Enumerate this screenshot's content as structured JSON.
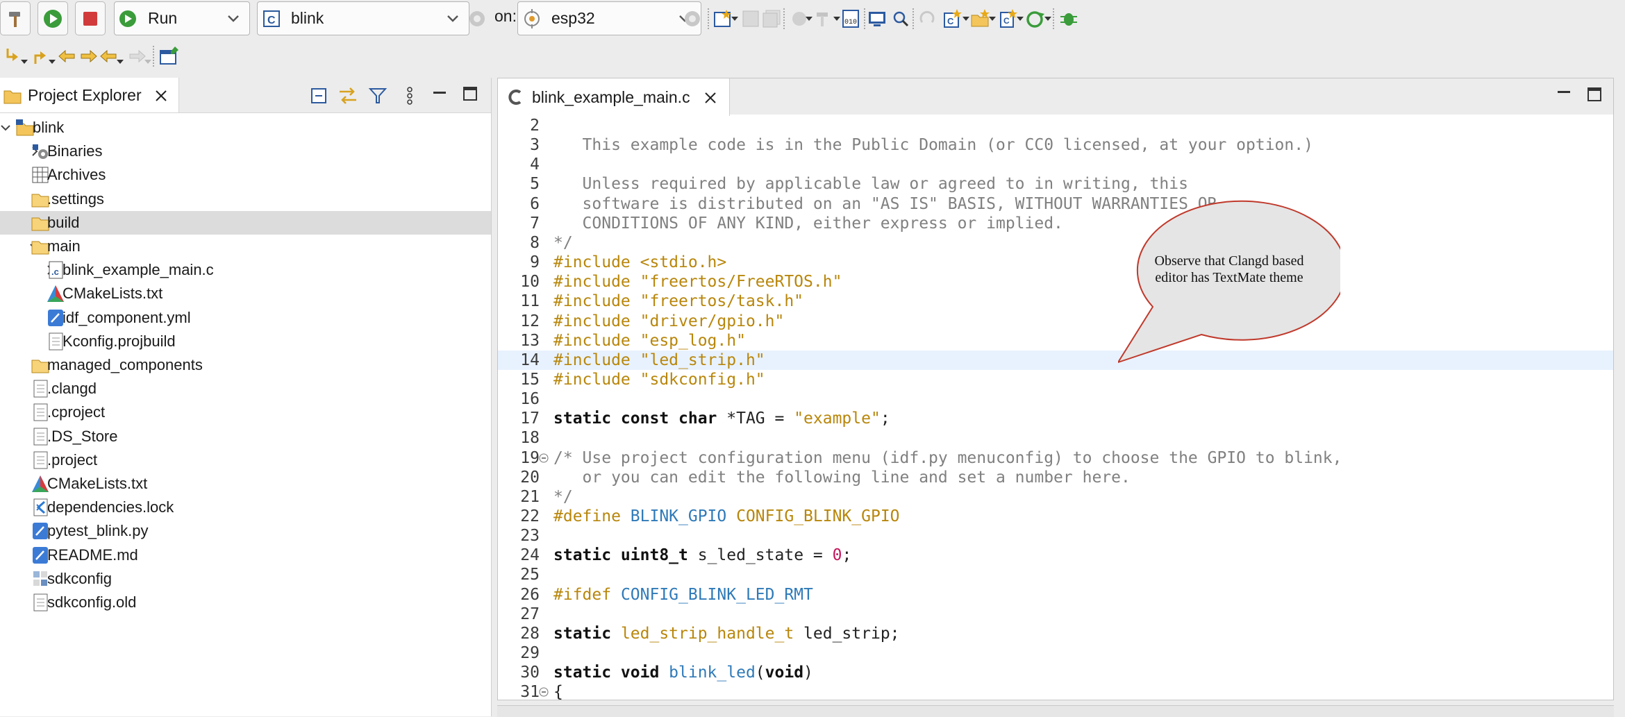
{
  "toolbar": {
    "run_mode": "Run",
    "launch_config": "blink",
    "on_label": "on:",
    "target": "esp32"
  },
  "explorer": {
    "title": "Project Explorer",
    "tree": [
      {
        "label": "blink",
        "depth": 0,
        "twisty": "expanded",
        "icon": "project-folder-icon"
      },
      {
        "label": "Binaries",
        "depth": 1,
        "twisty": "collapsed",
        "icon": "binaries-icon"
      },
      {
        "label": "Archives",
        "depth": 1,
        "twisty": "collapsed",
        "icon": "archives-icon"
      },
      {
        "label": ".settings",
        "depth": 1,
        "twisty": "collapsed",
        "icon": "folder-icon"
      },
      {
        "label": "build",
        "depth": 1,
        "twisty": "collapsed",
        "icon": "folder-icon",
        "selected": true
      },
      {
        "label": "main",
        "depth": 1,
        "twisty": "expanded",
        "icon": "folder-icon"
      },
      {
        "label": "blink_example_main.c",
        "depth": 2,
        "twisty": "collapsed",
        "icon": "c-file-icon"
      },
      {
        "label": "CMakeLists.txt",
        "depth": 2,
        "twisty": "none",
        "icon": "cmake-icon"
      },
      {
        "label": "idf_component.yml",
        "depth": 2,
        "twisty": "none",
        "icon": "yml-file-icon"
      },
      {
        "label": "Kconfig.projbuild",
        "depth": 2,
        "twisty": "none",
        "icon": "text-file-icon"
      },
      {
        "label": "managed_components",
        "depth": 1,
        "twisty": "collapsed",
        "icon": "folder-icon"
      },
      {
        "label": ".clangd",
        "depth": 1,
        "twisty": "none",
        "icon": "text-file-icon"
      },
      {
        "label": ".cproject",
        "depth": 1,
        "twisty": "none",
        "icon": "text-file-icon"
      },
      {
        "label": ".DS_Store",
        "depth": 1,
        "twisty": "none",
        "icon": "text-file-icon"
      },
      {
        "label": ".project",
        "depth": 1,
        "twisty": "none",
        "icon": "text-file-icon"
      },
      {
        "label": "CMakeLists.txt",
        "depth": 1,
        "twisty": "none",
        "icon": "cmake-icon"
      },
      {
        "label": "dependencies.lock",
        "depth": 1,
        "twisty": "none",
        "icon": "vscode-file-icon"
      },
      {
        "label": "pytest_blink.py",
        "depth": 1,
        "twisty": "none",
        "icon": "py-file-icon"
      },
      {
        "label": "README.md",
        "depth": 1,
        "twisty": "none",
        "icon": "md-file-icon"
      },
      {
        "label": "sdkconfig",
        "depth": 1,
        "twisty": "none",
        "icon": "sdkconfig-icon"
      },
      {
        "label": "sdkconfig.old",
        "depth": 1,
        "twisty": "none",
        "icon": "text-file-icon"
      }
    ]
  },
  "editor": {
    "tab_title": "blink_example_main.c",
    "current_line": 14,
    "lines": [
      {
        "n": "2",
        "tokens": []
      },
      {
        "n": "3",
        "tokens": [
          [
            "comment",
            "   This example code is in the Public Domain (or CC0 licensed, at your option.)"
          ]
        ]
      },
      {
        "n": "4",
        "tokens": []
      },
      {
        "n": "5",
        "tokens": [
          [
            "comment",
            "   Unless required by applicable law or agreed to in writing, this"
          ]
        ]
      },
      {
        "n": "6",
        "tokens": [
          [
            "comment",
            "   software is distributed on an \"AS IS\" BASIS, WITHOUT WARRANTIES OR"
          ]
        ]
      },
      {
        "n": "7",
        "tokens": [
          [
            "comment",
            "   CONDITIONS OF ANY KIND, either express or implied."
          ]
        ]
      },
      {
        "n": "8",
        "tokens": [
          [
            "comment",
            "*/"
          ]
        ]
      },
      {
        "n": "9",
        "tokens": [
          [
            "pre",
            "#include "
          ],
          [
            "str",
            "<stdio.h>"
          ]
        ]
      },
      {
        "n": "10",
        "tokens": [
          [
            "pre",
            "#include "
          ],
          [
            "str",
            "\"freertos/FreeRTOS.h\""
          ]
        ]
      },
      {
        "n": "11",
        "tokens": [
          [
            "pre",
            "#include "
          ],
          [
            "str",
            "\"freertos/task.h\""
          ]
        ]
      },
      {
        "n": "12",
        "tokens": [
          [
            "pre",
            "#include "
          ],
          [
            "str",
            "\"driver/gpio.h\""
          ]
        ]
      },
      {
        "n": "13",
        "tokens": [
          [
            "pre",
            "#include "
          ],
          [
            "str",
            "\"esp_log.h\""
          ]
        ]
      },
      {
        "n": "14",
        "tokens": [
          [
            "pre",
            "#include "
          ],
          [
            "str",
            "\"led_strip.h\""
          ]
        ]
      },
      {
        "n": "15",
        "tokens": [
          [
            "pre",
            "#include "
          ],
          [
            "str",
            "\"sdkconfig.h\""
          ]
        ]
      },
      {
        "n": "16",
        "tokens": []
      },
      {
        "n": "17",
        "tokens": [
          [
            "kw",
            "static const char "
          ],
          [
            "plain",
            "*TAG = "
          ],
          [
            "str",
            "\"example\""
          ],
          [
            "plain",
            ";"
          ]
        ]
      },
      {
        "n": "18",
        "tokens": []
      },
      {
        "n": "19",
        "fold": true,
        "tokens": [
          [
            "comment",
            "/* Use project configuration menu (idf.py menuconfig) to choose the GPIO to blink,"
          ]
        ]
      },
      {
        "n": "20",
        "tokens": [
          [
            "comment",
            "   or you can edit the following line and set a number here."
          ]
        ]
      },
      {
        "n": "21",
        "tokens": [
          [
            "comment",
            "*/"
          ]
        ]
      },
      {
        "n": "22",
        "tokens": [
          [
            "pre",
            "#define "
          ],
          [
            "macro",
            "BLINK_GPIO "
          ],
          [
            "pre",
            "CONFIG_BLINK_GPIO"
          ]
        ]
      },
      {
        "n": "23",
        "tokens": []
      },
      {
        "n": "24",
        "tokens": [
          [
            "kw",
            "static uint8_t "
          ],
          [
            "plain",
            "s_led_state = "
          ],
          [
            "num",
            "0"
          ],
          [
            "plain",
            ";"
          ]
        ]
      },
      {
        "n": "25",
        "tokens": []
      },
      {
        "n": "26",
        "tokens": [
          [
            "pre",
            "#ifdef "
          ],
          [
            "macro",
            "CONFIG_BLINK_LED_RMT"
          ]
        ]
      },
      {
        "n": "27",
        "tokens": []
      },
      {
        "n": "28",
        "tokens": [
          [
            "kw",
            "static "
          ],
          [
            "pre",
            "led_strip_handle_t "
          ],
          [
            "plain",
            "led_strip;"
          ]
        ]
      },
      {
        "n": "29",
        "tokens": []
      },
      {
        "n": "30",
        "tokens": [
          [
            "kw",
            "static void "
          ],
          [
            "fn",
            "blink_led"
          ],
          [
            "plain",
            "("
          ],
          [
            "kw",
            "void"
          ],
          [
            "plain",
            ")"
          ]
        ]
      },
      {
        "n": "31",
        "fold": true,
        "tokens": [
          [
            "plain",
            "{"
          ]
        ]
      }
    ]
  },
  "callout": {
    "line1": "Observe that Clangd based",
    "line2": "editor has TextMate theme"
  },
  "colors": {
    "selection": "#dcdcdc",
    "current_line": "#e8f2fe",
    "preprocessor": "#b8860b",
    "string": "#b8860b",
    "comment": "#808080",
    "macro": "#2f7ab8",
    "number": "#c2185b",
    "callout_fill": "#e5e5e5",
    "callout_stroke": "#c0392b"
  }
}
